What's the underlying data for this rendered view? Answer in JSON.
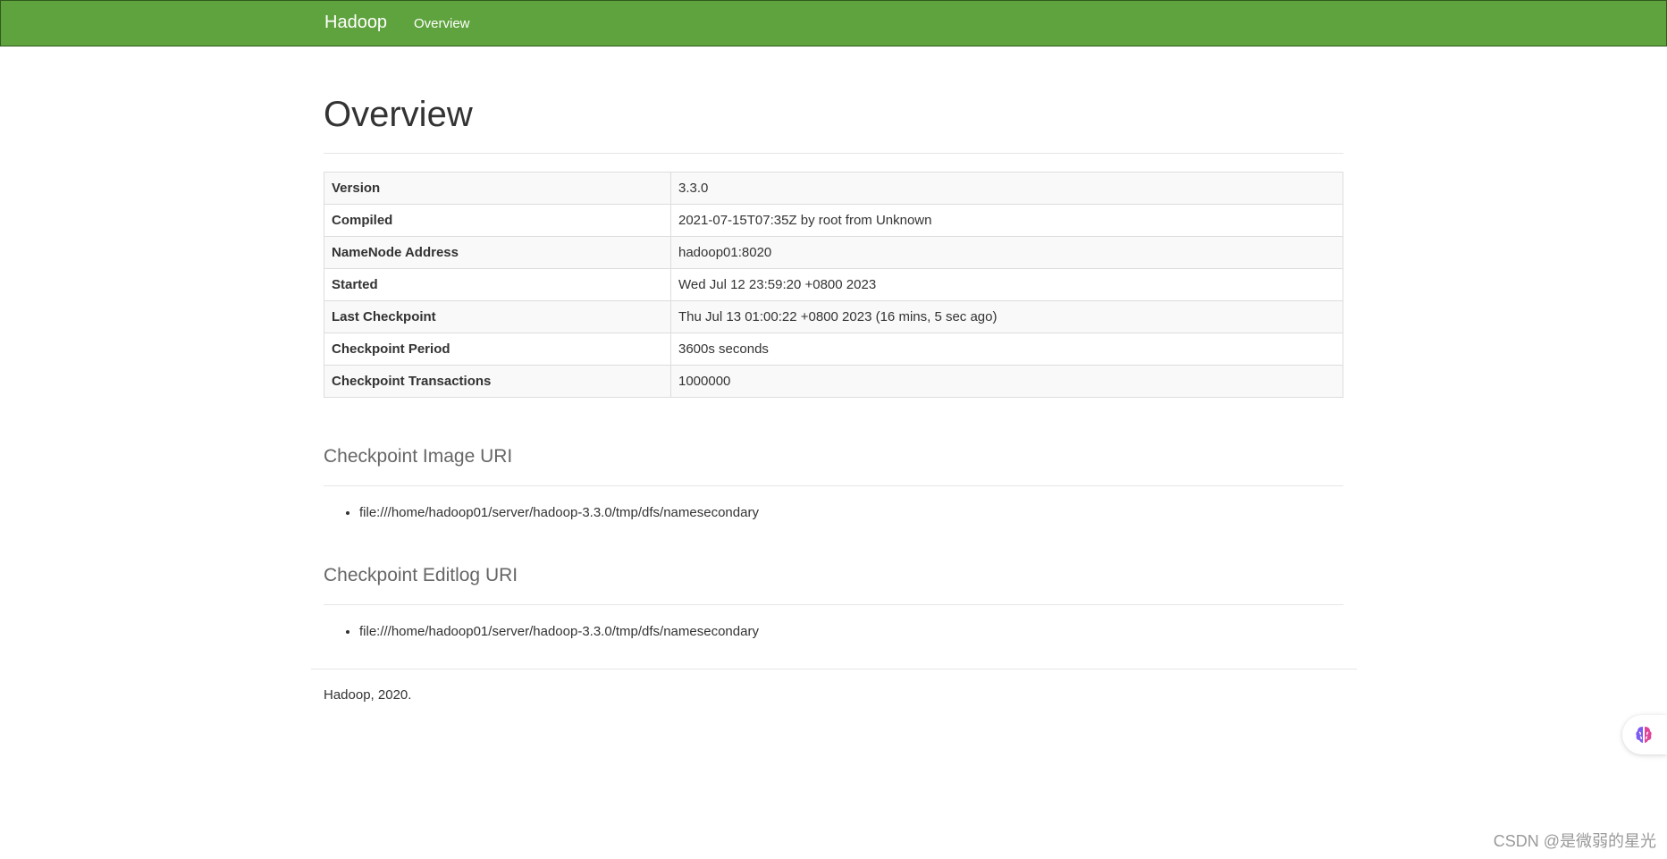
{
  "navbar": {
    "brand": "Hadoop",
    "links": [
      {
        "label": "Overview"
      }
    ]
  },
  "page_title": "Overview",
  "overview_table": [
    {
      "key": "Version",
      "value": "3.3.0"
    },
    {
      "key": "Compiled",
      "value": "2021-07-15T07:35Z by root from Unknown"
    },
    {
      "key": "NameNode Address",
      "value": "hadoop01:8020"
    },
    {
      "key": "Started",
      "value": "Wed Jul 12 23:59:20 +0800 2023"
    },
    {
      "key": "Last Checkpoint",
      "value": "Thu Jul 13 01:00:22 +0800 2023 (16 mins, 5 sec ago)"
    },
    {
      "key": "Checkpoint Period",
      "value": "3600s seconds"
    },
    {
      "key": "Checkpoint Transactions",
      "value": "1000000"
    }
  ],
  "image_uri": {
    "title": "Checkpoint Image URI",
    "items": [
      "file:///home/hadoop01/server/hadoop-3.3.0/tmp/dfs/namesecondary"
    ]
  },
  "editlog_uri": {
    "title": "Checkpoint Editlog URI",
    "items": [
      "file:///home/hadoop01/server/hadoop-3.3.0/tmp/dfs/namesecondary"
    ]
  },
  "footer": "Hadoop, 2020.",
  "floating_button": {
    "icon": "brain-icon"
  },
  "watermark": "CSDN @是微弱的星光",
  "colors": {
    "navbar_bg": "#5fa33e",
    "navbar_text": "#ffffff"
  }
}
